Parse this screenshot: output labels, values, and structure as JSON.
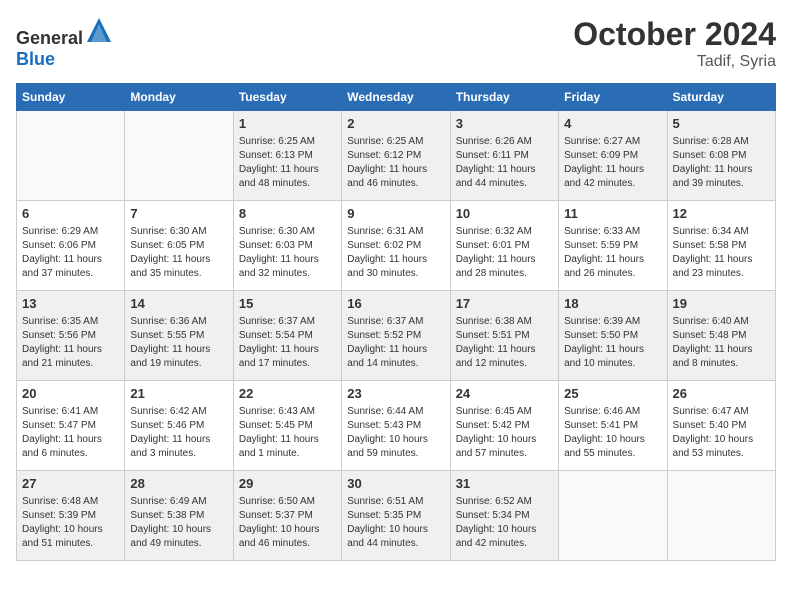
{
  "header": {
    "logo_general": "General",
    "logo_blue": "Blue",
    "month": "October 2024",
    "location": "Tadif, Syria"
  },
  "weekdays": [
    "Sunday",
    "Monday",
    "Tuesday",
    "Wednesday",
    "Thursday",
    "Friday",
    "Saturday"
  ],
  "weeks": [
    [
      {
        "day": "",
        "info": ""
      },
      {
        "day": "",
        "info": ""
      },
      {
        "day": "1",
        "info": "Sunrise: 6:25 AM\nSunset: 6:13 PM\nDaylight: 11 hours and 48 minutes."
      },
      {
        "day": "2",
        "info": "Sunrise: 6:25 AM\nSunset: 6:12 PM\nDaylight: 11 hours and 46 minutes."
      },
      {
        "day": "3",
        "info": "Sunrise: 6:26 AM\nSunset: 6:11 PM\nDaylight: 11 hours and 44 minutes."
      },
      {
        "day": "4",
        "info": "Sunrise: 6:27 AM\nSunset: 6:09 PM\nDaylight: 11 hours and 42 minutes."
      },
      {
        "day": "5",
        "info": "Sunrise: 6:28 AM\nSunset: 6:08 PM\nDaylight: 11 hours and 39 minutes."
      }
    ],
    [
      {
        "day": "6",
        "info": "Sunrise: 6:29 AM\nSunset: 6:06 PM\nDaylight: 11 hours and 37 minutes."
      },
      {
        "day": "7",
        "info": "Sunrise: 6:30 AM\nSunset: 6:05 PM\nDaylight: 11 hours and 35 minutes."
      },
      {
        "day": "8",
        "info": "Sunrise: 6:30 AM\nSunset: 6:03 PM\nDaylight: 11 hours and 32 minutes."
      },
      {
        "day": "9",
        "info": "Sunrise: 6:31 AM\nSunset: 6:02 PM\nDaylight: 11 hours and 30 minutes."
      },
      {
        "day": "10",
        "info": "Sunrise: 6:32 AM\nSunset: 6:01 PM\nDaylight: 11 hours and 28 minutes."
      },
      {
        "day": "11",
        "info": "Sunrise: 6:33 AM\nSunset: 5:59 PM\nDaylight: 11 hours and 26 minutes."
      },
      {
        "day": "12",
        "info": "Sunrise: 6:34 AM\nSunset: 5:58 PM\nDaylight: 11 hours and 23 minutes."
      }
    ],
    [
      {
        "day": "13",
        "info": "Sunrise: 6:35 AM\nSunset: 5:56 PM\nDaylight: 11 hours and 21 minutes."
      },
      {
        "day": "14",
        "info": "Sunrise: 6:36 AM\nSunset: 5:55 PM\nDaylight: 11 hours and 19 minutes."
      },
      {
        "day": "15",
        "info": "Sunrise: 6:37 AM\nSunset: 5:54 PM\nDaylight: 11 hours and 17 minutes."
      },
      {
        "day": "16",
        "info": "Sunrise: 6:37 AM\nSunset: 5:52 PM\nDaylight: 11 hours and 14 minutes."
      },
      {
        "day": "17",
        "info": "Sunrise: 6:38 AM\nSunset: 5:51 PM\nDaylight: 11 hours and 12 minutes."
      },
      {
        "day": "18",
        "info": "Sunrise: 6:39 AM\nSunset: 5:50 PM\nDaylight: 11 hours and 10 minutes."
      },
      {
        "day": "19",
        "info": "Sunrise: 6:40 AM\nSunset: 5:48 PM\nDaylight: 11 hours and 8 minutes."
      }
    ],
    [
      {
        "day": "20",
        "info": "Sunrise: 6:41 AM\nSunset: 5:47 PM\nDaylight: 11 hours and 6 minutes."
      },
      {
        "day": "21",
        "info": "Sunrise: 6:42 AM\nSunset: 5:46 PM\nDaylight: 11 hours and 3 minutes."
      },
      {
        "day": "22",
        "info": "Sunrise: 6:43 AM\nSunset: 5:45 PM\nDaylight: 11 hours and 1 minute."
      },
      {
        "day": "23",
        "info": "Sunrise: 6:44 AM\nSunset: 5:43 PM\nDaylight: 10 hours and 59 minutes."
      },
      {
        "day": "24",
        "info": "Sunrise: 6:45 AM\nSunset: 5:42 PM\nDaylight: 10 hours and 57 minutes."
      },
      {
        "day": "25",
        "info": "Sunrise: 6:46 AM\nSunset: 5:41 PM\nDaylight: 10 hours and 55 minutes."
      },
      {
        "day": "26",
        "info": "Sunrise: 6:47 AM\nSunset: 5:40 PM\nDaylight: 10 hours and 53 minutes."
      }
    ],
    [
      {
        "day": "27",
        "info": "Sunrise: 6:48 AM\nSunset: 5:39 PM\nDaylight: 10 hours and 51 minutes."
      },
      {
        "day": "28",
        "info": "Sunrise: 6:49 AM\nSunset: 5:38 PM\nDaylight: 10 hours and 49 minutes."
      },
      {
        "day": "29",
        "info": "Sunrise: 6:50 AM\nSunset: 5:37 PM\nDaylight: 10 hours and 46 minutes."
      },
      {
        "day": "30",
        "info": "Sunrise: 6:51 AM\nSunset: 5:35 PM\nDaylight: 10 hours and 44 minutes."
      },
      {
        "day": "31",
        "info": "Sunrise: 6:52 AM\nSunset: 5:34 PM\nDaylight: 10 hours and 42 minutes."
      },
      {
        "day": "",
        "info": ""
      },
      {
        "day": "",
        "info": ""
      }
    ]
  ],
  "row_styles": [
    "shaded",
    "white",
    "shaded",
    "white",
    "shaded"
  ]
}
